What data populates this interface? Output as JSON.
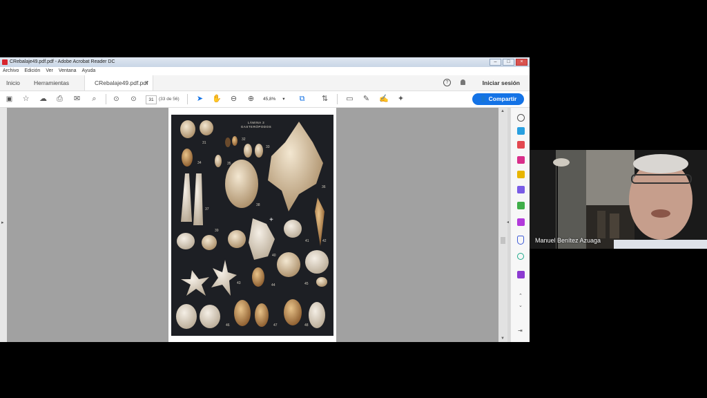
{
  "window": {
    "title": "CRebalaje49.pdf.pdf - Adobe Acrobat Reader DC",
    "menu": [
      "Archivo",
      "Edición",
      "Ver",
      "Ventana",
      "Ayuda"
    ]
  },
  "tabs": {
    "home": "Inicio",
    "tools": "Herramientas",
    "document": "CRebalaje49.pdf.pdf",
    "close": "×",
    "signin": "Iniciar sesión"
  },
  "toolbar": {
    "page_current": "31",
    "page_count": "(33 de 56)",
    "zoom": "45,8%",
    "share_label": "Compartir",
    "icons": [
      "save-icon",
      "star-icon",
      "upload-icon",
      "print-icon",
      "mail-icon",
      "search-icon",
      "prev-page-icon",
      "next-page-icon",
      "select-arrow-icon",
      "hand-icon",
      "zoom-out-icon",
      "zoom-in-icon",
      "page-fit-icon",
      "scroll-mode-icon",
      "comment-icon",
      "pen-icon",
      "sign-icon",
      "stamp-icon"
    ]
  },
  "document": {
    "plate_title_line1": "LÁMINA 3",
    "plate_title_line2": "GASTERÓPODOS",
    "numbers": [
      "31",
      "32",
      "33",
      "34",
      "35",
      "36",
      "37",
      "38",
      "39",
      "40",
      "41",
      "42",
      "43",
      "44",
      "45",
      "46",
      "47",
      "48"
    ]
  },
  "right_panel_icons": [
    "zoom-icon",
    "edit-pdf-icon",
    "export-pdf-icon",
    "create-pdf-icon",
    "comment-tool-icon",
    "combine-icon",
    "organize-icon",
    "fill-sign-icon",
    "protect-icon",
    "compress-icon",
    "more-tools-icon"
  ],
  "webcam": {
    "participant_name": "Manuel Benítez Azuaga"
  },
  "colors": {
    "share_button": "#1473e6",
    "acrobat_red": "#d8262f"
  }
}
